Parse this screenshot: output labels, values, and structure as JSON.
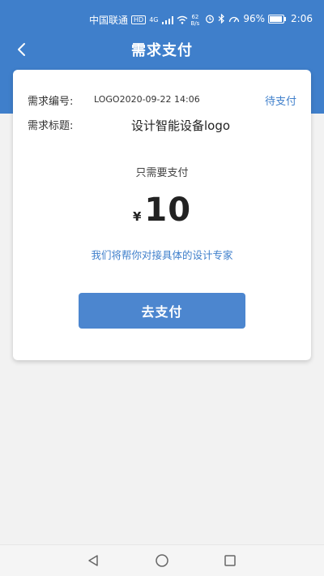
{
  "status_bar": {
    "carrier": "中国联通",
    "hd": "HD",
    "net": "4G",
    "speed_value": "62",
    "speed_unit": "B/s",
    "battery": "96%",
    "time": "2:06"
  },
  "nav": {
    "title": "需求支付"
  },
  "order": {
    "number_label": "需求编号:",
    "number_value": "LOGO2020-09-22 14:06",
    "status": "待支付",
    "title_label": "需求标题:",
    "title_value": "设计智能设备logo"
  },
  "payment": {
    "hint": "只需要支付",
    "currency": "¥",
    "amount": "10",
    "tip": "我们将帮你对接具体的设计专家",
    "button_label": "去支付"
  },
  "colors": {
    "primary": "#3f7fcb",
    "button": "#4c86cf",
    "background": "#f2f2f2"
  },
  "icons": {
    "back": "back-arrow-icon",
    "sys_back": "triangle-back-icon",
    "sys_home": "circle-home-icon",
    "sys_recent": "square-recent-icon"
  }
}
